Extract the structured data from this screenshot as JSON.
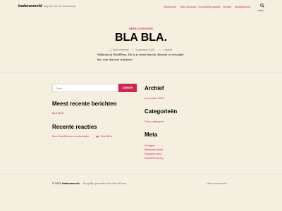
{
  "header": {
    "site_title": "badenwereld",
    "tagline": "Nog een site van WordPress",
    "nav": [
      "Afrekenen",
      "Mijn account",
      "Voorbeeld pagina",
      "Winkel",
      "Winkelmand"
    ],
    "search_label": "Zoeken"
  },
  "post": {
    "category": "GEEN CATEGORIE",
    "title": "BLA BLA.",
    "author": "Door viekenbe",
    "date": "3 november 2020",
    "comments": "1 reactie",
    "content": "Welkom bij WordPress. Dit is je eerste bericht. Bewerk of verwijder het, start dan met schrijven!"
  },
  "search_widget": {
    "placeholder": "Zoek ...",
    "button": "ZOEKEN"
  },
  "recent_posts": {
    "heading": "Meest recente berichten",
    "items": [
      "BLA BLA."
    ]
  },
  "recent_comments": {
    "heading": "Recente reacties",
    "author": "Een WordPress-commentator",
    "on": "op",
    "post": "BLA BLA."
  },
  "archive": {
    "heading": "Archief",
    "items": [
      "november 2020"
    ]
  },
  "categories": {
    "heading": "Categorieën",
    "items": [
      "Geen categorie"
    ]
  },
  "meta_widget": {
    "heading": "Meta",
    "items": [
      "Inloggen",
      "Berichten feed",
      "Reacties feed",
      "WordPress.org"
    ]
  },
  "footer": {
    "copyright_prefix": "© 2021",
    "site_name": "badenwereld",
    "powered": "Mogelijk gemaakt door WordPress",
    "to_top": "Naar bovenkant ↑"
  },
  "colors": {
    "accent": "#cd2653",
    "background": "#f5efe0"
  }
}
